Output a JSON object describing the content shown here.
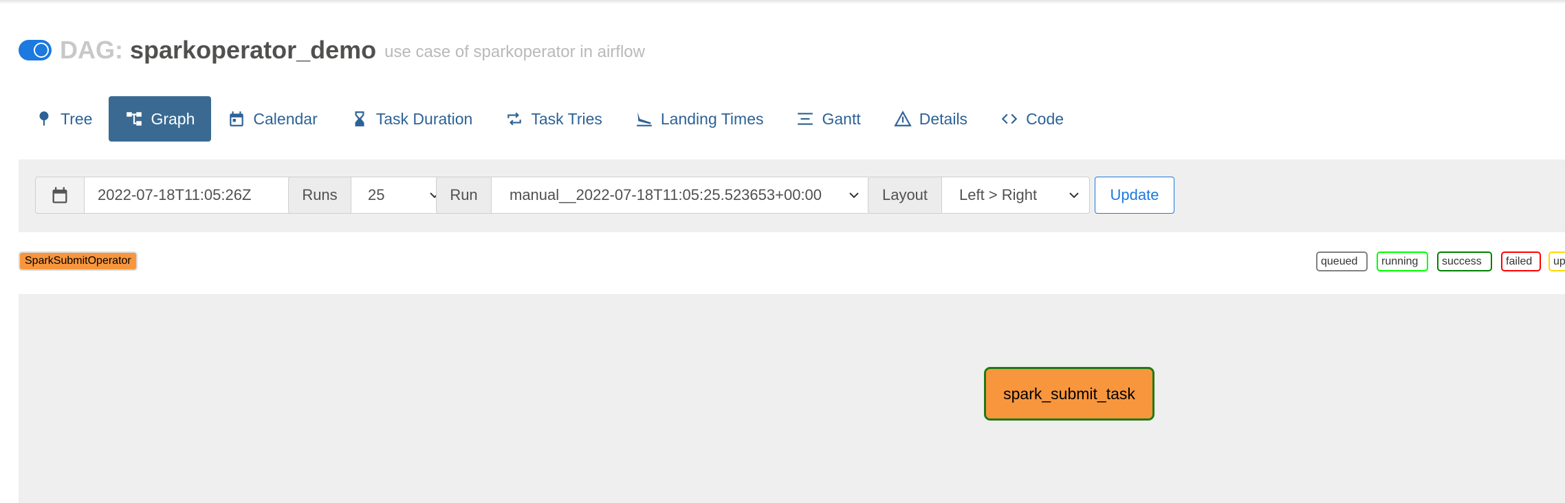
{
  "header": {
    "dag_prefix": "DAG:",
    "dag_id": "sparkoperator_demo",
    "description": "use case of sparkoperator in airflow",
    "toggle_state": "on"
  },
  "tabs": [
    {
      "label": "Tree",
      "icon": "tree-pin-icon",
      "active": false
    },
    {
      "label": "Graph",
      "icon": "graph-icon",
      "active": true
    },
    {
      "label": "Calendar",
      "icon": "calendar-icon",
      "active": false
    },
    {
      "label": "Task Duration",
      "icon": "hourglass-icon",
      "active": false
    },
    {
      "label": "Task Tries",
      "icon": "repeat-icon",
      "active": false
    },
    {
      "label": "Landing Times",
      "icon": "plane-landing-icon",
      "active": false
    },
    {
      "label": "Gantt",
      "icon": "gantt-icon",
      "active": false
    },
    {
      "label": "Details",
      "icon": "warning-triangle-icon",
      "active": false
    },
    {
      "label": "Code",
      "icon": "code-icon",
      "active": false
    }
  ],
  "controls": {
    "base_date": "2022-07-18T11:05:26Z",
    "runs_label": "Runs",
    "runs_value": "25",
    "run_label": "Run",
    "run_value": "manual__2022-07-18T11:05:25.523653+00:00",
    "layout_label": "Layout",
    "layout_value": "Left > Right",
    "update_label": "Update"
  },
  "legend": {
    "operators": [
      {
        "label": "SparkSubmitOperator",
        "color": "#f7963d"
      }
    ],
    "states": [
      {
        "label": "queued",
        "color": "#808080"
      },
      {
        "label": "running",
        "color": "#00ff00"
      },
      {
        "label": "success",
        "color": "#008000"
      },
      {
        "label": "failed",
        "color": "#ff0000"
      },
      {
        "label": "up",
        "color": "#ffd700"
      }
    ]
  },
  "graph": {
    "nodes": [
      {
        "label": "spark_submit_task",
        "operator": "SparkSubmitOperator",
        "state": "success"
      }
    ]
  }
}
